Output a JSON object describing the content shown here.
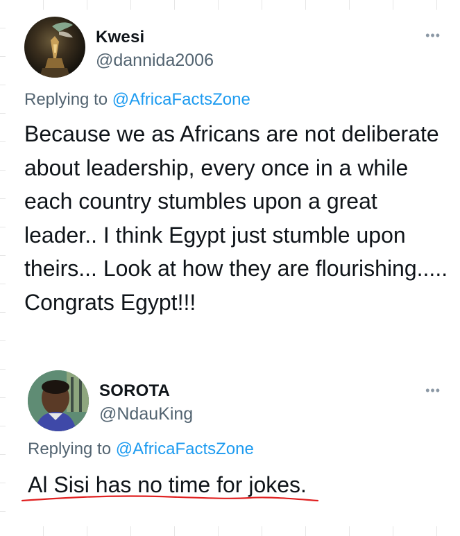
{
  "tweets": [
    {
      "author_name": "Kwesi",
      "author_handle": "@dannida2006",
      "replying_prefix": "Replying to",
      "replying_to": "@AfricaFactsZone",
      "more_glyph": "•••",
      "text": "Because we as Africans are not deliberate about leadership, every once in a while each country stumbles upon a great leader.. I think Egypt just stumble upon theirs... Look at how they are flourishing..... Congrats Egypt!!!"
    },
    {
      "author_name": "SOROTA",
      "author_handle": "@NdauKing",
      "replying_prefix": "Replying to",
      "replying_to": "@AfricaFactsZone",
      "more_glyph": "•••",
      "text": "Al Sisi has no time for jokes."
    }
  ],
  "colors": {
    "text": "#0f1419",
    "secondary": "#536471",
    "mention": "#1d9bf0",
    "annotation_underline": "#e02020"
  },
  "icons": {
    "more": "more-options-icon",
    "underline": "red-handdrawn-underline"
  }
}
